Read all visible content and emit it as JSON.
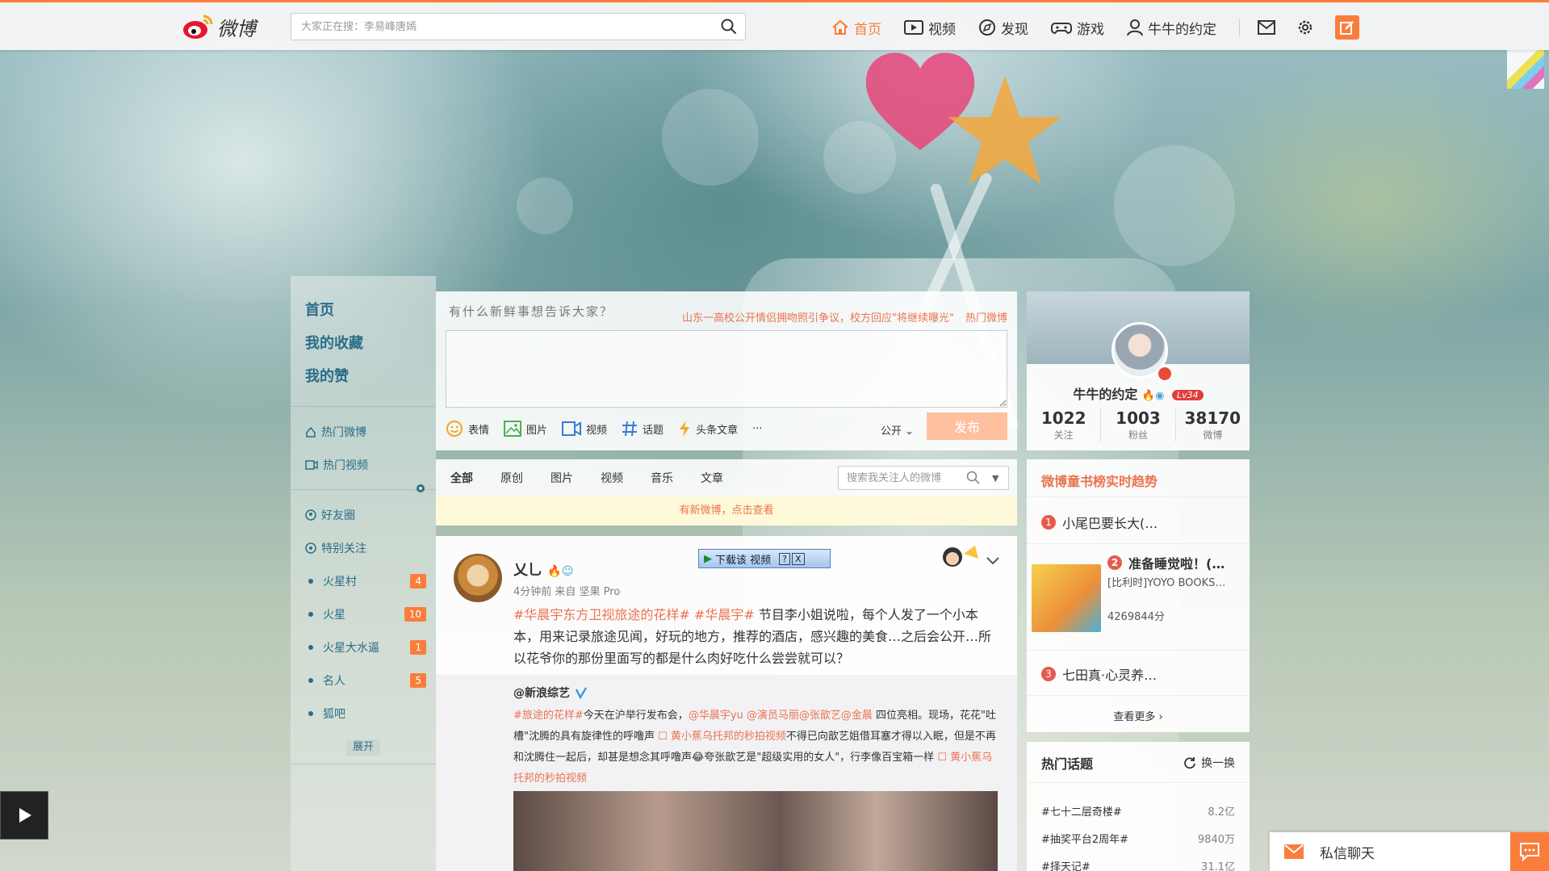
{
  "topbar": {
    "logo_text": "微博",
    "search_placeholder": "大家正在搜：李易峰唐嫣",
    "nav": [
      {
        "label": "首页",
        "icon": "home-icon",
        "active": true
      },
      {
        "label": "视频",
        "icon": "video-icon"
      },
      {
        "label": "发现",
        "icon": "compass-icon"
      },
      {
        "label": "游戏",
        "icon": "gamepad-icon"
      },
      {
        "label": "牛牛的约定",
        "icon": "user-icon"
      }
    ],
    "icons": [
      "mail-icon",
      "gear-icon",
      "compose-icon"
    ],
    "accent_color": "#fa7d3c"
  },
  "left_nav": {
    "main": [
      "首页",
      "我的收藏",
      "我的赞"
    ],
    "hot": [
      {
        "label": "热门微博",
        "icon": "fire-icon"
      },
      {
        "label": "热门视频",
        "icon": "video-icon"
      }
    ],
    "groups": [
      {
        "label": "好友圈",
        "icon": "friends-icon"
      },
      {
        "label": "特别关注",
        "icon": "eye-icon"
      }
    ],
    "lists": [
      {
        "label": "火星村",
        "badge": "4"
      },
      {
        "label": "火星",
        "badge": "10"
      },
      {
        "label": "火星大水逼",
        "badge": "1"
      },
      {
        "label": "名人",
        "badge": "5"
      },
      {
        "label": "狐吧",
        "badge": ""
      }
    ],
    "expand_label": "展开"
  },
  "composer": {
    "hint": "有什么新鲜事想告诉大家？",
    "trend_text": "山东一高校公开情侣拥吻照引争议，校方回应\"将继续曝光\"",
    "trend_hot": "热门微博",
    "tools": [
      {
        "label": "表情",
        "icon": "smiley-icon"
      },
      {
        "label": "图片",
        "icon": "image-icon"
      },
      {
        "label": "视频",
        "icon": "video-icon"
      },
      {
        "label": "话题",
        "icon": "hashtag-icon"
      },
      {
        "label": "头条文章",
        "icon": "lightning-icon"
      },
      {
        "label": "···",
        "icon": "more-icon"
      }
    ],
    "privacy": "公开",
    "submit": "发布"
  },
  "feed_tabs": {
    "tabs": [
      "全部",
      "原创",
      "图片",
      "视频",
      "音乐",
      "文章"
    ],
    "active": "全部",
    "search_placeholder": "搜索我关注人的微博",
    "new_notice": "有新微博，点击查看"
  },
  "post": {
    "author": "乂乚",
    "time": "4分钟前",
    "source": "来自 坚果 Pro",
    "tags": [
      "#华晨宇东方卫视旅途的花样#",
      "#华晨宇#"
    ],
    "text": "节目李小姐说啦，每个人发了一个小本本，用来记录旅途见闻，好玩的地方，推荐的酒店，感兴趣的美食…之后会公开…所以花爷你的那份里面写的都是什么肉好吃什么尝尝就可以？",
    "download_btn": "下载该 视频",
    "repost": {
      "author": "@新浪综艺",
      "segments": [
        {
          "t": "#旅途的花样#",
          "c": "tag"
        },
        {
          "t": "今天在沪举行发布会，",
          "c": ""
        },
        {
          "t": "@华晨宇yu @演员马丽@张歆艺@金晨",
          "c": "tag"
        },
        {
          "t": " 四位亮相。现场，花花\"吐槽\"沈腾的具有旋律性的呼噜声 ",
          "c": ""
        },
        {
          "t": "☐ 黄小蕉乌托邦的秒拍视频",
          "c": "tag"
        },
        {
          "t": "不得已向歆艺姐借耳塞才得以入眠，但是不再和沈腾住一起后，却甚是想念其呼噜声",
          "c": ""
        },
        {
          "t": "😂",
          "c": ""
        },
        {
          "t": "夸张歆艺是\"超级实用的女人\"，行李像百宝箱一样 ",
          "c": ""
        },
        {
          "t": "☐ 黄小蕉乌托邦的秒拍视频",
          "c": "tag"
        }
      ]
    }
  },
  "profile": {
    "name": "牛牛的约定",
    "level": "Lv34",
    "stats": [
      {
        "num": "1022",
        "label": "关注"
      },
      {
        "num": "1003",
        "label": "粉丝"
      },
      {
        "num": "38170",
        "label": "微博"
      }
    ]
  },
  "trend_panel": {
    "title": "微博童书榜实时趋势",
    "items": [
      {
        "rank": "1",
        "title": "小尾巴要长大(…"
      },
      {
        "rank": "2",
        "title": "准备睡觉啦！(…",
        "sub": "[比利时]YOYO BOOKS…",
        "score": "4269844分"
      },
      {
        "rank": "3",
        "title": "七田真·心灵养…"
      }
    ],
    "more": "查看更多"
  },
  "topics_panel": {
    "title": "热门话题",
    "refresh": "换一换",
    "items": [
      {
        "topic": "#七十二层奇楼#",
        "count": "8.2亿"
      },
      {
        "topic": "#抽奖平台2周年#",
        "count": "9840万"
      },
      {
        "topic": "#择天记#",
        "count": "31.1亿"
      }
    ]
  },
  "chat": {
    "label": "私信聊天"
  }
}
